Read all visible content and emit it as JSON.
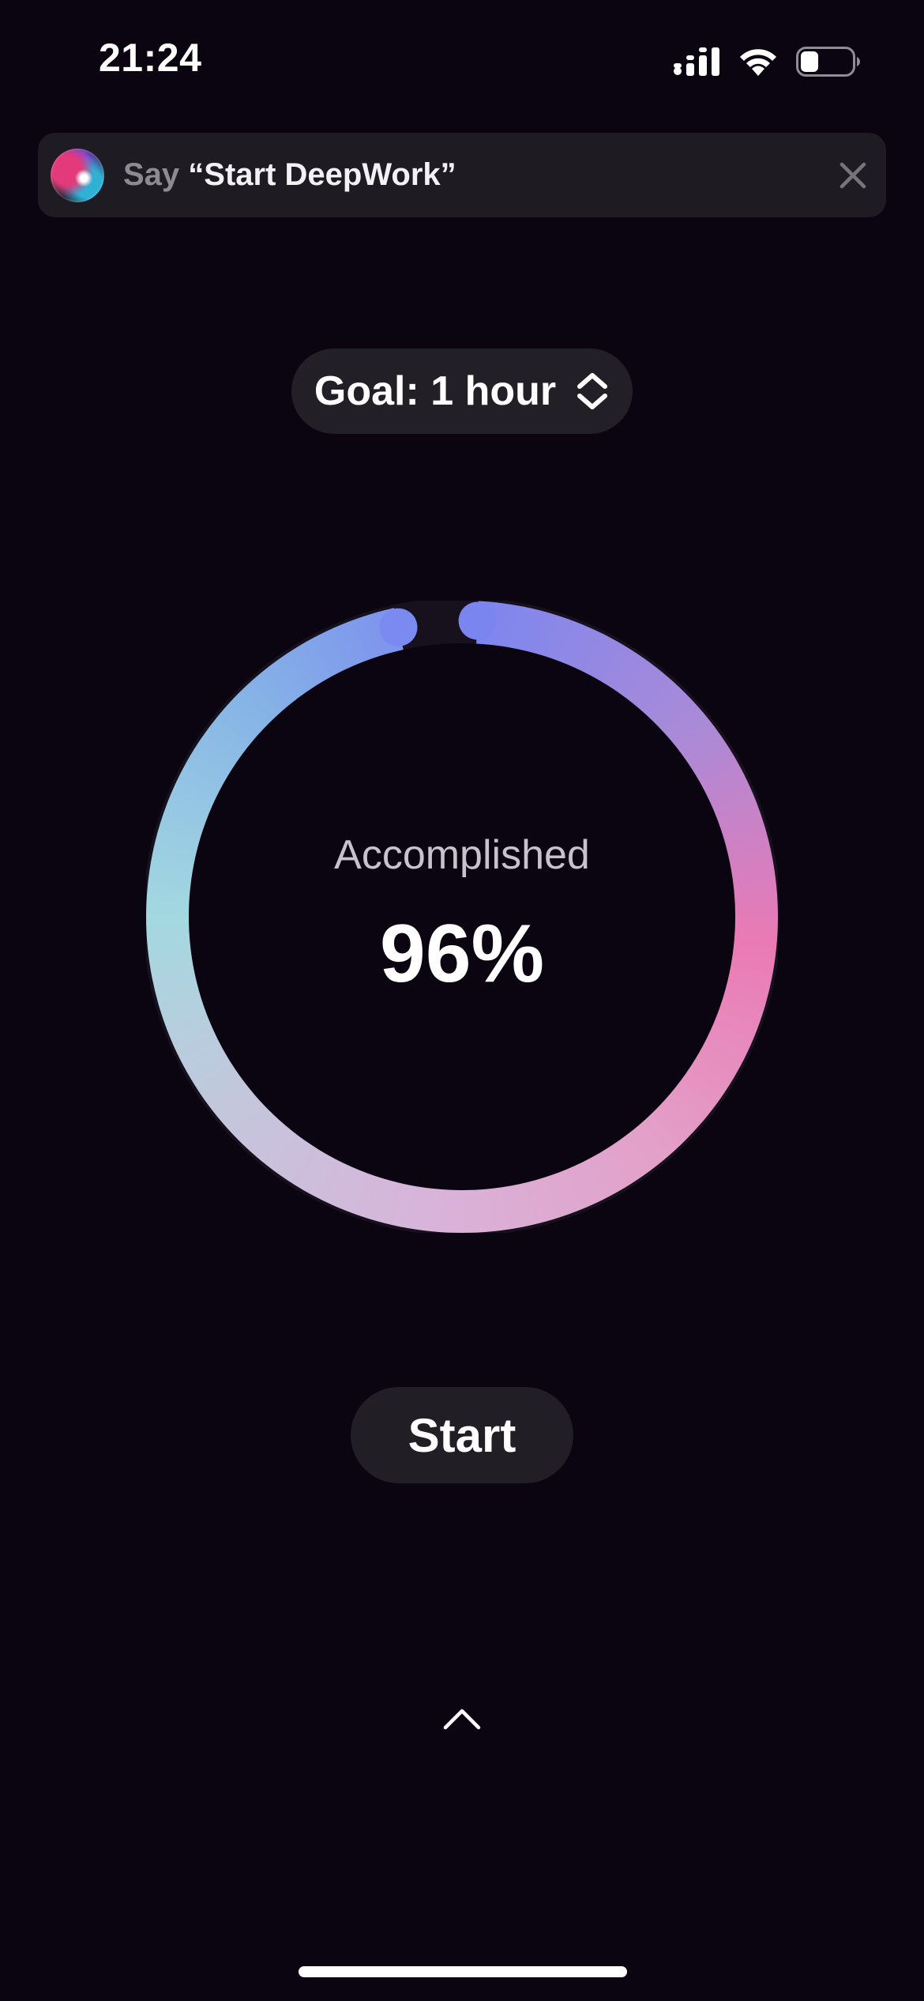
{
  "status_bar": {
    "time": "21:24",
    "icons": [
      "signal-icon",
      "wifi-icon",
      "battery-icon"
    ],
    "battery_level": 0.35
  },
  "siri_suggestion": {
    "prefix": "Say",
    "phrase": "“Start DeepWork”",
    "icons": [
      "siri-orb-icon",
      "close-icon"
    ]
  },
  "goal": {
    "label": "Goal: 1 hour",
    "icon": "chevron-up-down-icon"
  },
  "progress": {
    "title": "Accomplished",
    "value_text": "96%",
    "fraction": 0.96,
    "colors": {
      "track": "#16101d",
      "gradient_top": "#7a86f0",
      "gradient_right": "#ea7ab4",
      "gradient_bottom": "#d9b3da",
      "gradient_left": "#a4d8e0"
    }
  },
  "start_button": {
    "label": "Start"
  },
  "bottom": {
    "icon": "chevron-up-icon"
  },
  "colors": {
    "background": "#0b0411",
    "pill": "#221f26",
    "banner": "#1e1c22"
  }
}
